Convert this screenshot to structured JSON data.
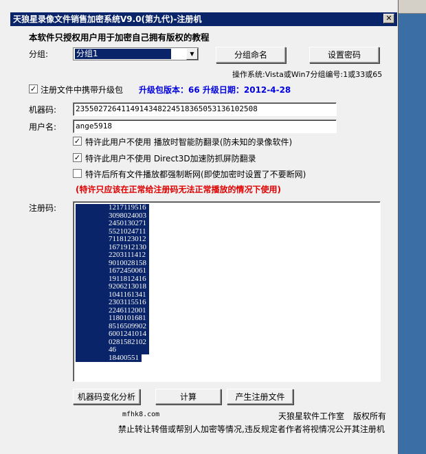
{
  "window": {
    "title": "天狼星录像文件销售加密系统V9.0(第九代)-注册机",
    "close_glyph": "✕"
  },
  "notice": "本软件只授权用户用于加密自己拥有版权的教程",
  "group": {
    "label": "分组:",
    "selected": "分组1",
    "rename_button": "分组命名",
    "password_button": "设置密码",
    "os_info": "操作系统:Vista或Win7分组编号:1或33或65"
  },
  "upgrade": {
    "checkbox_label": "注册文件中携带升级包",
    "checked": true,
    "info": "升级包版本：66  升级日期：2012-4-28"
  },
  "machine_code": {
    "label": "机器码:",
    "value": "2355027264114914348224518365053136102508"
  },
  "username": {
    "label": "用户名:",
    "value": "ange5918"
  },
  "options": [
    {
      "label": "特许此用户不使用  播放时智能防翻录(防未知的录像软件)",
      "checked": true
    },
    {
      "label": "特许此用户不使用  Direct3D加速防抓屏防翻录",
      "checked": true
    },
    {
      "label": "特许后所有文件播放都强制断网(即使加密时设置了不要断网)",
      "checked": false
    }
  ],
  "warning": "(特许只应该在正常给注册码无法正常播放的情况下使用)",
  "reg_code": {
    "label": "注册码:",
    "lines": [
      "1217119516",
      "3098024003",
      "2450130271",
      "5521024711",
      "7118123012",
      "1671912130",
      "2203111412",
      "9010028158",
      "1672450061",
      "1911812416",
      "9206213018",
      "1041161341",
      "2303115516",
      "2246112001",
      "1180101681",
      "8516509902",
      "6001241014",
      "0281582102",
      "46",
      "18400551"
    ]
  },
  "buttons": {
    "analyze": "机器码变化分析",
    "calculate": "计算",
    "generate": "产生注册文件"
  },
  "footer": {
    "website": "mfhk8.com",
    "studio": "天狼星软件工作室",
    "rights": "版权所有",
    "disclaimer": "禁止转让转借或帮别人加密等情况,违反规定者作者将视情况公开其注册机"
  },
  "colors": {
    "titlebar": "#0a246a",
    "warning": "#e00000",
    "upgrade_info": "#0000e0"
  }
}
